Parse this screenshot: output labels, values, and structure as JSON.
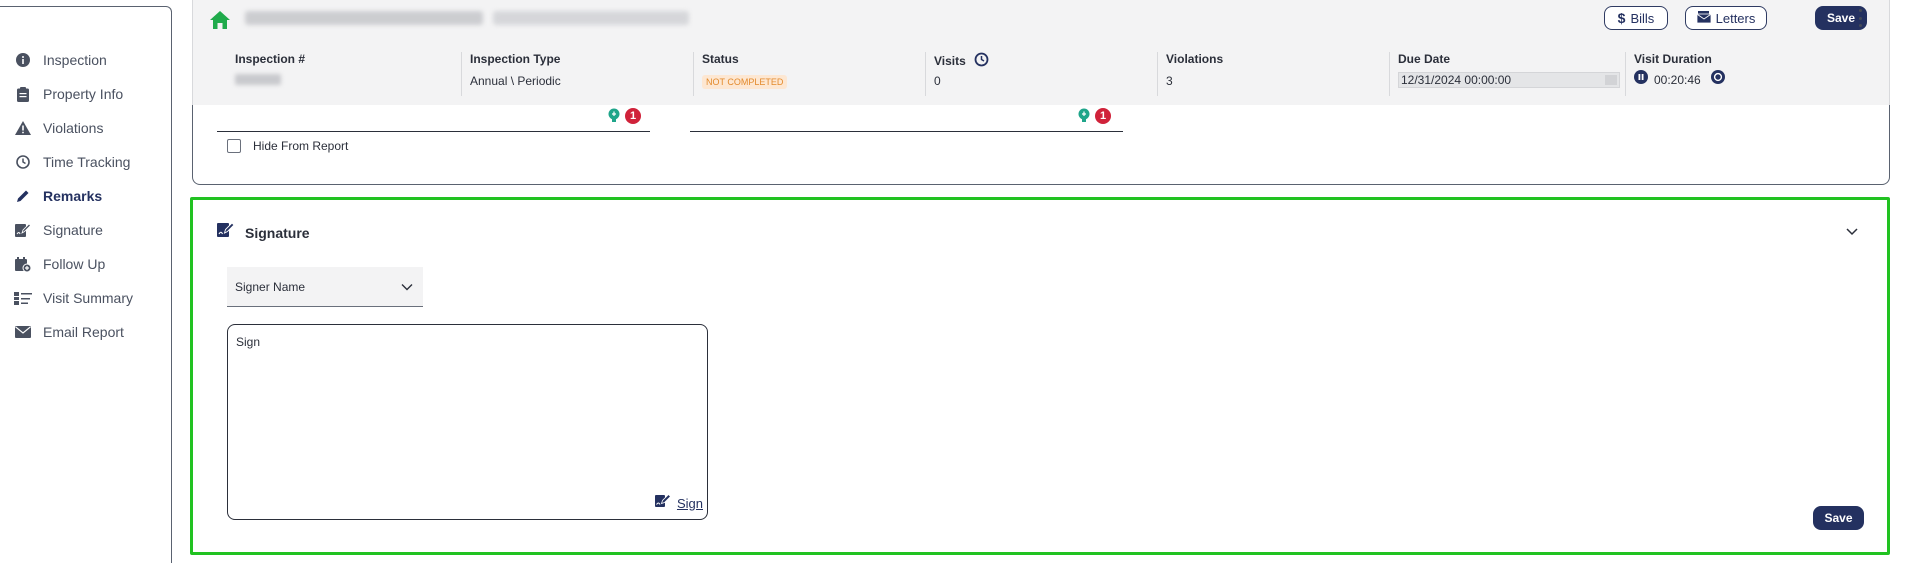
{
  "sidebar": {
    "items": [
      {
        "label": "Inspection",
        "icon": "info-circle-icon"
      },
      {
        "label": "Property Info",
        "icon": "clipboard-icon"
      },
      {
        "label": "Violations",
        "icon": "warning-triangle-icon"
      },
      {
        "label": "Time Tracking",
        "icon": "clock-icon"
      },
      {
        "label": "Remarks",
        "icon": "pencil-icon",
        "active": true
      },
      {
        "label": "Signature",
        "icon": "signature-icon"
      },
      {
        "label": "Follow Up",
        "icon": "calendar-plus-icon"
      },
      {
        "label": "Visit Summary",
        "icon": "list-summary-icon"
      },
      {
        "label": "Email Report",
        "icon": "envelope-icon"
      }
    ]
  },
  "header": {
    "bills_label": "Bills",
    "letters_label": "Letters",
    "save_label": "Save",
    "fields": {
      "inspection_no": {
        "label": "Inspection #"
      },
      "inspection_type": {
        "label": "Inspection Type",
        "value": "Annual \\ Periodic"
      },
      "status": {
        "label": "Status",
        "value": "NOT COMPLETED"
      },
      "visits": {
        "label": "Visits",
        "value": "0"
      },
      "violations": {
        "label": "Violations",
        "value": "3"
      },
      "due_date": {
        "label": "Due Date",
        "value": "12/31/2024 00:00:00"
      },
      "visit_duration": {
        "label": "Visit Duration",
        "value": "00:20:46"
      }
    }
  },
  "remarks": {
    "badge_a": "1",
    "badge_b": "1",
    "hide_label": "Hide From Report"
  },
  "signature": {
    "title": "Signature",
    "signer_placeholder": "Signer Name",
    "sign_placeholder": "Sign",
    "sign_link": "Sign",
    "save_label": "Save"
  },
  "colors": {
    "primary": "#243160",
    "highlight": "#21c221",
    "badge_red": "#d0223a",
    "home_green": "#1faa4b",
    "status_orange": "#e38a2c"
  }
}
